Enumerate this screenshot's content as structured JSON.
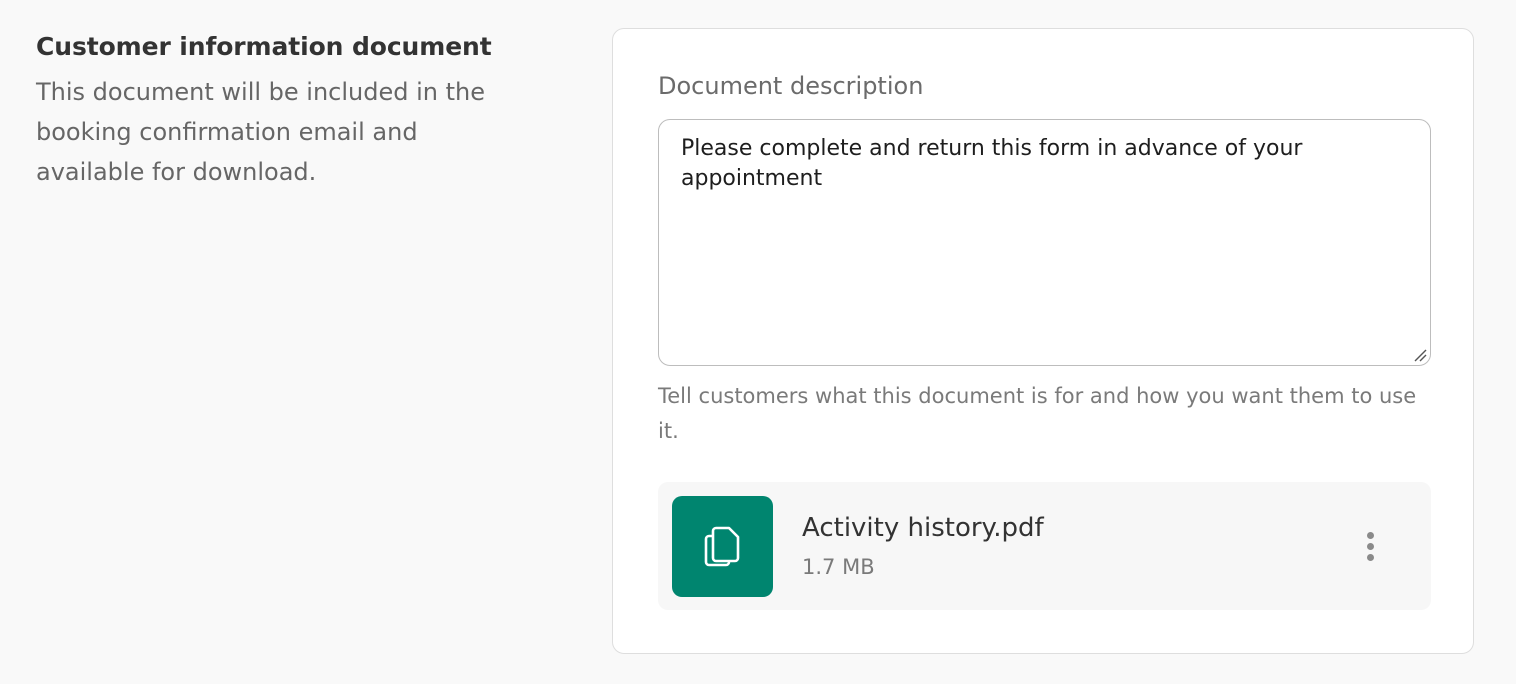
{
  "section": {
    "title": "Customer information document",
    "description": "This document will be included in the booking confirmation email and available for download."
  },
  "form": {
    "description_label": "Document description",
    "description_value": "Please complete and return this form in advance of your appointment",
    "helper_text": "Tell customers what this document is for and how you want them to use it."
  },
  "file": {
    "name": "Activity history.pdf",
    "size": "1.7 MB",
    "icon": "document-copy-icon",
    "thumb_color": "#00856f"
  },
  "icons": {
    "more": "more-vertical-icon",
    "resize": "resize-handle-icon"
  }
}
